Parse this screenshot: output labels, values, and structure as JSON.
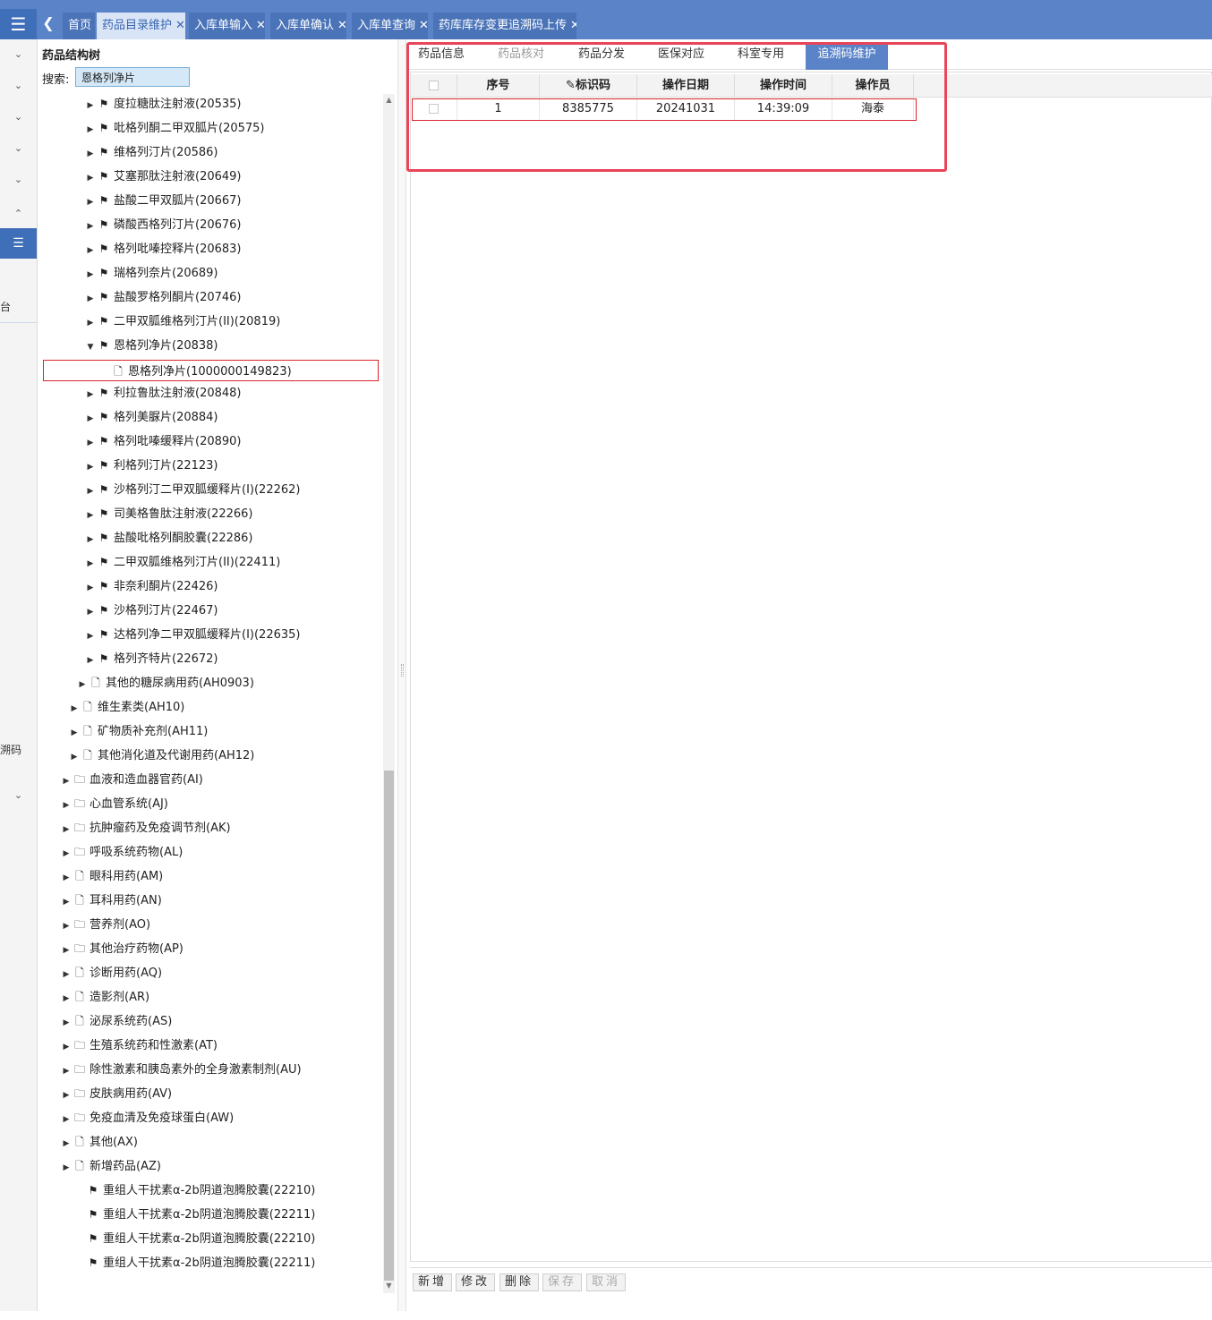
{
  "tabs": [
    {
      "label": "首页"
    },
    {
      "label": "药品目录维护"
    },
    {
      "label": "入库单输入"
    },
    {
      "label": "入库单确认"
    },
    {
      "label": "入库单查询"
    },
    {
      "label": "药库库存变更追溯码上传"
    }
  ],
  "sidenav": {
    "menu_icon": "☰",
    "fragment1": "台",
    "fragment2": "溯码"
  },
  "tree_panel": {
    "title": "药品结构树",
    "search_label": "搜索:",
    "search_value": "恩格列净片",
    "nodes": [
      {
        "label": "度拉糖肽注射液(20535)",
        "icon": "flag",
        "expand": "collapsed"
      },
      {
        "label": "吡格列酮二甲双胍片(20575)",
        "icon": "flag",
        "expand": "collapsed"
      },
      {
        "label": "维格列汀片(20586)",
        "icon": "flag",
        "expand": "collapsed"
      },
      {
        "label": "艾塞那肽注射液(20649)",
        "icon": "flag",
        "expand": "collapsed"
      },
      {
        "label": "盐酸二甲双胍片(20667)",
        "icon": "flag",
        "expand": "collapsed"
      },
      {
        "label": "磷酸西格列汀片(20676)",
        "icon": "flag",
        "expand": "collapsed"
      },
      {
        "label": "格列吡嗪控释片(20683)",
        "icon": "flag",
        "expand": "collapsed"
      },
      {
        "label": "瑞格列奈片(20689)",
        "icon": "flag",
        "expand": "collapsed"
      },
      {
        "label": "盐酸罗格列酮片(20746)",
        "icon": "flag",
        "expand": "collapsed"
      },
      {
        "label": "二甲双胍维格列汀片(II)(20819)",
        "icon": "flag",
        "expand": "collapsed"
      },
      {
        "label": "恩格列净片(20838)",
        "icon": "flag",
        "expand": "expanded"
      },
      {
        "label": "恩格列净片(1000000149823)",
        "icon": "file",
        "expand": "none"
      },
      {
        "label": "利拉鲁肽注射液(20848)",
        "icon": "flag",
        "expand": "collapsed"
      },
      {
        "label": "格列美脲片(20884)",
        "icon": "flag",
        "expand": "collapsed"
      },
      {
        "label": "格列吡嗪缓释片(20890)",
        "icon": "flag",
        "expand": "collapsed"
      },
      {
        "label": "利格列汀片(22123)",
        "icon": "flag",
        "expand": "collapsed"
      },
      {
        "label": "沙格列汀二甲双胍缓释片(Ⅰ)(22262)",
        "icon": "flag",
        "expand": "collapsed"
      },
      {
        "label": "司美格鲁肽注射液(22266)",
        "icon": "flag",
        "expand": "collapsed"
      },
      {
        "label": "盐酸吡格列酮胶囊(22286)",
        "icon": "flag",
        "expand": "collapsed"
      },
      {
        "label": "二甲双胍维格列汀片(II)(22411)",
        "icon": "flag",
        "expand": "collapsed"
      },
      {
        "label": "非奈利酮片(22426)",
        "icon": "flag",
        "expand": "collapsed"
      },
      {
        "label": "沙格列汀片(22467)",
        "icon": "flag",
        "expand": "collapsed"
      },
      {
        "label": "达格列净二甲双胍缓释片(Ⅰ)(22635)",
        "icon": "flag",
        "expand": "collapsed"
      },
      {
        "label": "格列齐特片(22672)",
        "icon": "flag",
        "expand": "collapsed"
      },
      {
        "label": "其他的糖尿病用药(AH0903)",
        "icon": "file",
        "expand": "collapsed"
      },
      {
        "label": "维生素类(AH10)",
        "icon": "file",
        "expand": "collapsed"
      },
      {
        "label": "矿物质补充剂(AH11)",
        "icon": "file",
        "expand": "collapsed"
      },
      {
        "label": "其他消化道及代谢用药(AH12)",
        "icon": "file",
        "expand": "collapsed"
      },
      {
        "label": "血液和造血器官药(AI)",
        "icon": "folder",
        "expand": "collapsed"
      },
      {
        "label": "心血管系统(AJ)",
        "icon": "folder",
        "expand": "collapsed"
      },
      {
        "label": "抗肿瘤药及免疫调节剂(AK)",
        "icon": "folder",
        "expand": "collapsed"
      },
      {
        "label": "呼吸系统药物(AL)",
        "icon": "folder",
        "expand": "collapsed"
      },
      {
        "label": "眼科用药(AM)",
        "icon": "file",
        "expand": "collapsed"
      },
      {
        "label": "耳科用药(AN)",
        "icon": "file",
        "expand": "collapsed"
      },
      {
        "label": "营养剂(AO)",
        "icon": "folder",
        "expand": "collapsed"
      },
      {
        "label": "其他治疗药物(AP)",
        "icon": "folder",
        "expand": "collapsed"
      },
      {
        "label": "诊断用药(AQ)",
        "icon": "file",
        "expand": "collapsed"
      },
      {
        "label": "造影剂(AR)",
        "icon": "file",
        "expand": "collapsed"
      },
      {
        "label": "泌尿系统药(AS)",
        "icon": "file",
        "expand": "collapsed"
      },
      {
        "label": "生殖系统药和性激素(AT)",
        "icon": "folder",
        "expand": "collapsed"
      },
      {
        "label": "除性激素和胰岛素外的全身激素制剂(AU)",
        "icon": "folder",
        "expand": "collapsed"
      },
      {
        "label": "皮肤病用药(AV)",
        "icon": "folder",
        "expand": "collapsed"
      },
      {
        "label": "免疫血清及免疫球蛋白(AW)",
        "icon": "folder",
        "expand": "collapsed"
      },
      {
        "label": "其他(AX)",
        "icon": "file",
        "expand": "collapsed"
      },
      {
        "label": "新增药品(AZ)",
        "icon": "file",
        "expand": "collapsed"
      },
      {
        "label": "重组人干扰素α-2b阴道泡腾胶囊(22210)",
        "icon": "flag",
        "expand": "none"
      },
      {
        "label": "重组人干扰素α-2b阴道泡腾胶囊(22211)",
        "icon": "flag",
        "expand": "none"
      },
      {
        "label": "重组人干扰素α-2b阴道泡腾胶囊(22210)",
        "icon": "flag",
        "expand": "none"
      },
      {
        "label": "重组人干扰素α-2b阴道泡腾胶囊(22211)",
        "icon": "flag",
        "expand": "none"
      }
    ]
  },
  "sub_tabs": [
    {
      "label": "药品信息",
      "state": "normal"
    },
    {
      "label": "药品核对",
      "state": "disabled"
    },
    {
      "label": "药品分发",
      "state": "normal"
    },
    {
      "label": "医保对应",
      "state": "normal"
    },
    {
      "label": "科室专用",
      "state": "normal"
    },
    {
      "label": "追溯码维护",
      "state": "active"
    }
  ],
  "grid": {
    "columns": [
      "序号",
      "标识码",
      "操作日期",
      "操作时间",
      "操作员"
    ],
    "rows": [
      {
        "seq": "1",
        "code": "8385775",
        "date": "20241031",
        "time": "14:39:09",
        "operator": "海泰"
      }
    ]
  },
  "toolbar": {
    "add": "新增",
    "edit": "修改",
    "delete": "删除",
    "save": "保存",
    "cancel": "取消"
  },
  "colors": {
    "accent": "#5b84c8",
    "highlight": "#e8455a"
  }
}
